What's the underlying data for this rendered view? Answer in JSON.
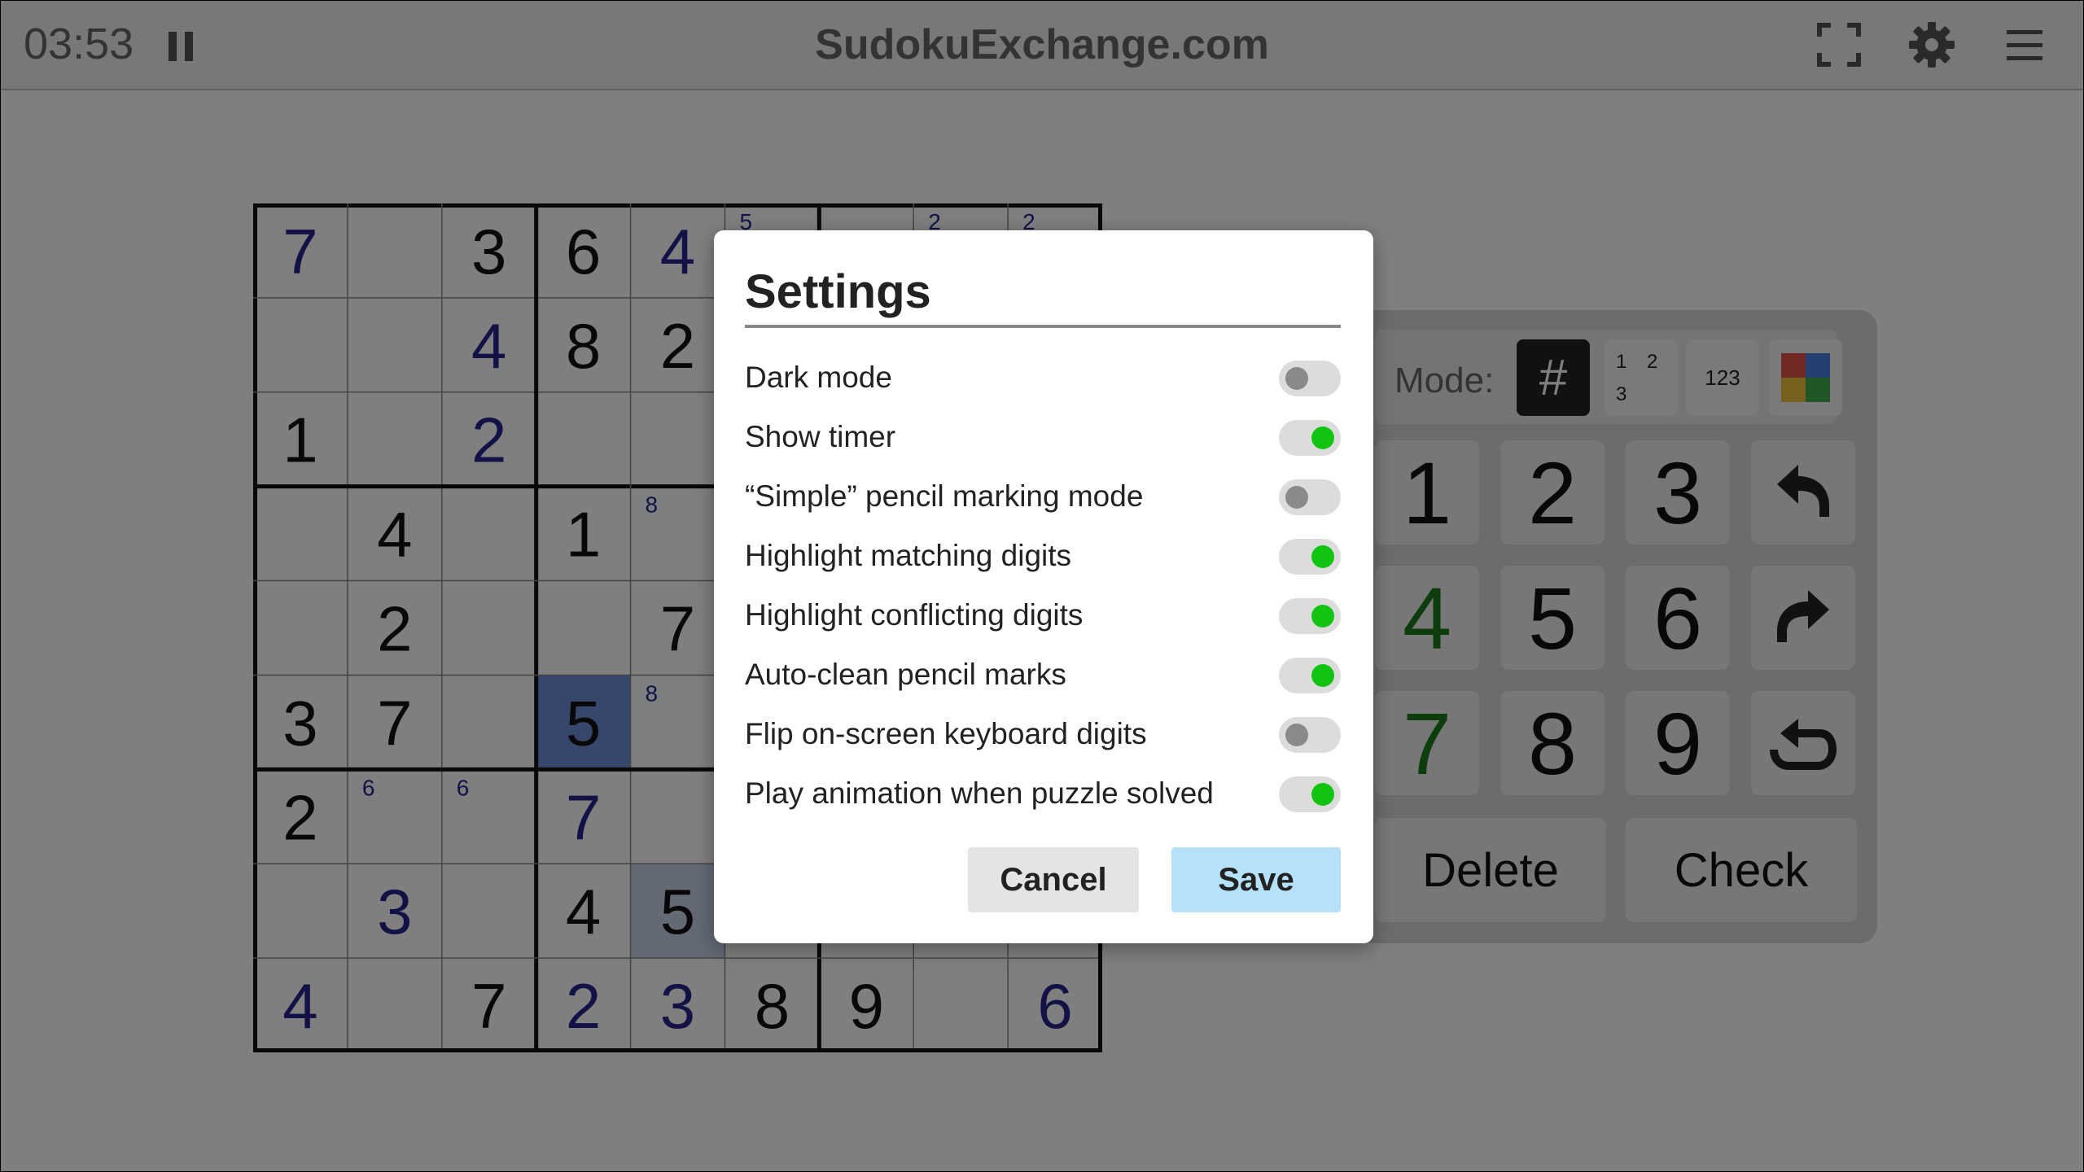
{
  "header": {
    "timer": "03:53",
    "site_title": "SudokuExchange.com",
    "icons": [
      "pause-icon",
      "fullscreen-icon",
      "gear-icon",
      "menu-icon"
    ]
  },
  "board": {
    "cells": [
      {
        "r": 0,
        "c": 0,
        "v": "7",
        "k": "entered"
      },
      {
        "r": 0,
        "c": 2,
        "v": "3",
        "k": "given"
      },
      {
        "r": 0,
        "c": 3,
        "v": "6",
        "k": "given"
      },
      {
        "r": 0,
        "c": 4,
        "v": "4",
        "k": "entered"
      },
      {
        "r": 0,
        "c": 5,
        "p": "5"
      },
      {
        "r": 0,
        "c": 7,
        "p": "2"
      },
      {
        "r": 0,
        "c": 8,
        "p": "2"
      },
      {
        "r": 1,
        "c": 2,
        "v": "4",
        "k": "entered"
      },
      {
        "r": 1,
        "c": 3,
        "v": "8",
        "k": "given"
      },
      {
        "r": 1,
        "c": 4,
        "v": "2",
        "k": "given"
      },
      {
        "r": 2,
        "c": 0,
        "v": "1",
        "k": "given"
      },
      {
        "r": 2,
        "c": 2,
        "v": "2",
        "k": "entered"
      },
      {
        "r": 3,
        "c": 1,
        "v": "4",
        "k": "given"
      },
      {
        "r": 3,
        "c": 3,
        "v": "1",
        "k": "given"
      },
      {
        "r": 3,
        "c": 4,
        "p": "8"
      },
      {
        "r": 4,
        "c": 1,
        "v": "2",
        "k": "given"
      },
      {
        "r": 4,
        "c": 4,
        "v": "7",
        "k": "given"
      },
      {
        "r": 5,
        "c": 0,
        "v": "3",
        "k": "given"
      },
      {
        "r": 5,
        "c": 1,
        "v": "7",
        "k": "given"
      },
      {
        "r": 5,
        "c": 3,
        "v": "5",
        "k": "given",
        "hl": "selected"
      },
      {
        "r": 5,
        "c": 4,
        "p": "8"
      },
      {
        "r": 6,
        "c": 0,
        "v": "2",
        "k": "given"
      },
      {
        "r": 6,
        "c": 1,
        "p": "6"
      },
      {
        "r": 6,
        "c": 2,
        "p": "6"
      },
      {
        "r": 6,
        "c": 3,
        "v": "7",
        "k": "entered"
      },
      {
        "r": 7,
        "c": 1,
        "v": "3",
        "k": "entered"
      },
      {
        "r": 7,
        "c": 3,
        "v": "4",
        "k": "given"
      },
      {
        "r": 7,
        "c": 4,
        "v": "5",
        "k": "given",
        "hl": "match"
      },
      {
        "r": 8,
        "c": 0,
        "v": "4",
        "k": "entered"
      },
      {
        "r": 8,
        "c": 2,
        "v": "7",
        "k": "given"
      },
      {
        "r": 8,
        "c": 3,
        "v": "2",
        "k": "entered"
      },
      {
        "r": 8,
        "c": 4,
        "v": "3",
        "k": "entered"
      },
      {
        "r": 8,
        "c": 5,
        "v": "8",
        "k": "given"
      },
      {
        "r": 8,
        "c": 6,
        "v": "9",
        "k": "given"
      },
      {
        "r": 8,
        "c": 8,
        "v": "6",
        "k": "entered"
      }
    ]
  },
  "keypad": {
    "mode_label": "Mode:",
    "mode_buttons": {
      "normal": "#",
      "corner": [
        "1",
        "2",
        "3"
      ],
      "centre": "123"
    },
    "digits": [
      "1",
      "2",
      "3",
      "4",
      "5",
      "6",
      "7",
      "8",
      "9"
    ],
    "delete_label": "Delete",
    "check_label": "Check"
  },
  "settings_dialog": {
    "title": "Settings",
    "options": [
      {
        "label": "Dark mode",
        "on": false
      },
      {
        "label": "Show timer",
        "on": true
      },
      {
        "label": "“Simple” pencil marking mode",
        "on": false
      },
      {
        "label": "Highlight matching digits",
        "on": true
      },
      {
        "label": "Highlight conflicting digits",
        "on": true
      },
      {
        "label": "Auto-clean pencil marks",
        "on": true
      },
      {
        "label": "Flip on-screen keyboard digits",
        "on": false
      },
      {
        "label": "Play animation when puzzle solved",
        "on": true
      }
    ],
    "cancel_label": "Cancel",
    "save_label": "Save"
  },
  "colors": {
    "entered_digit": "#25258f",
    "toggle_on": "#11c411",
    "save_button": "#b5e2fa",
    "selected_cell": "#6e8fd8",
    "matching_cell": "#c6d2ea"
  }
}
